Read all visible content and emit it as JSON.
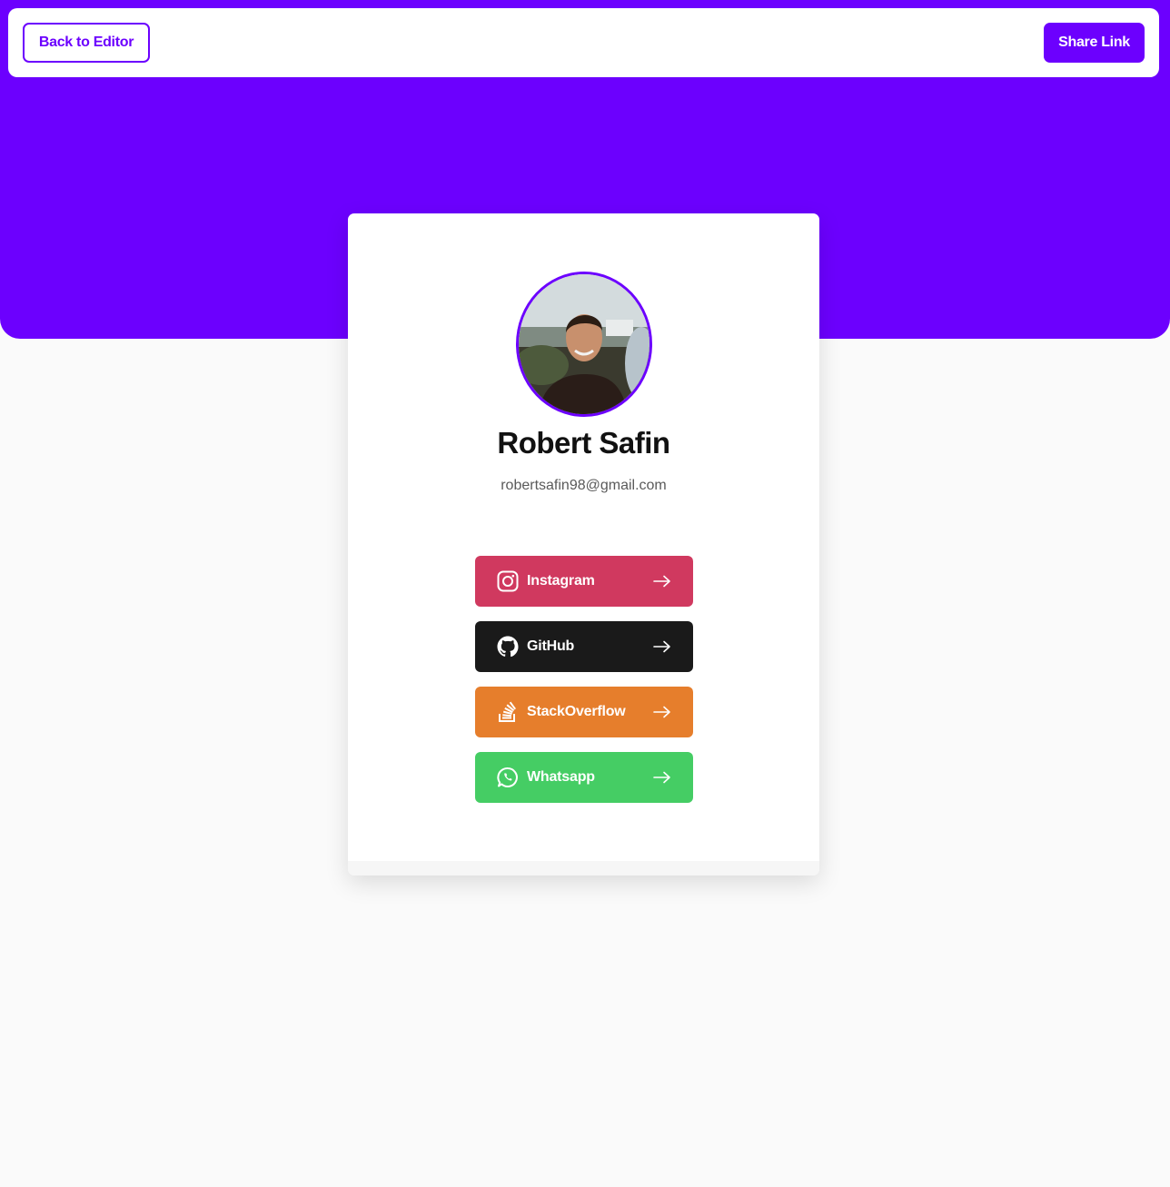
{
  "topbar": {
    "back_label": "Back to Editor",
    "share_label": "Share Link"
  },
  "profile": {
    "name": "Robert Safin",
    "email": "robertsafin98@gmail.com"
  },
  "links": [
    {
      "label": "Instagram",
      "icon": "instagram-icon",
      "color": "#d0395f"
    },
    {
      "label": "GitHub",
      "icon": "github-icon",
      "color": "#1a1a1a"
    },
    {
      "label": "StackOverflow",
      "icon": "stackoverflow-icon",
      "color": "#e67e2c"
    },
    {
      "label": "Whatsapp",
      "icon": "whatsapp-icon",
      "color": "#45cd64"
    }
  ],
  "colors": {
    "accent": "#6c00fe",
    "background": "#fafafa"
  }
}
